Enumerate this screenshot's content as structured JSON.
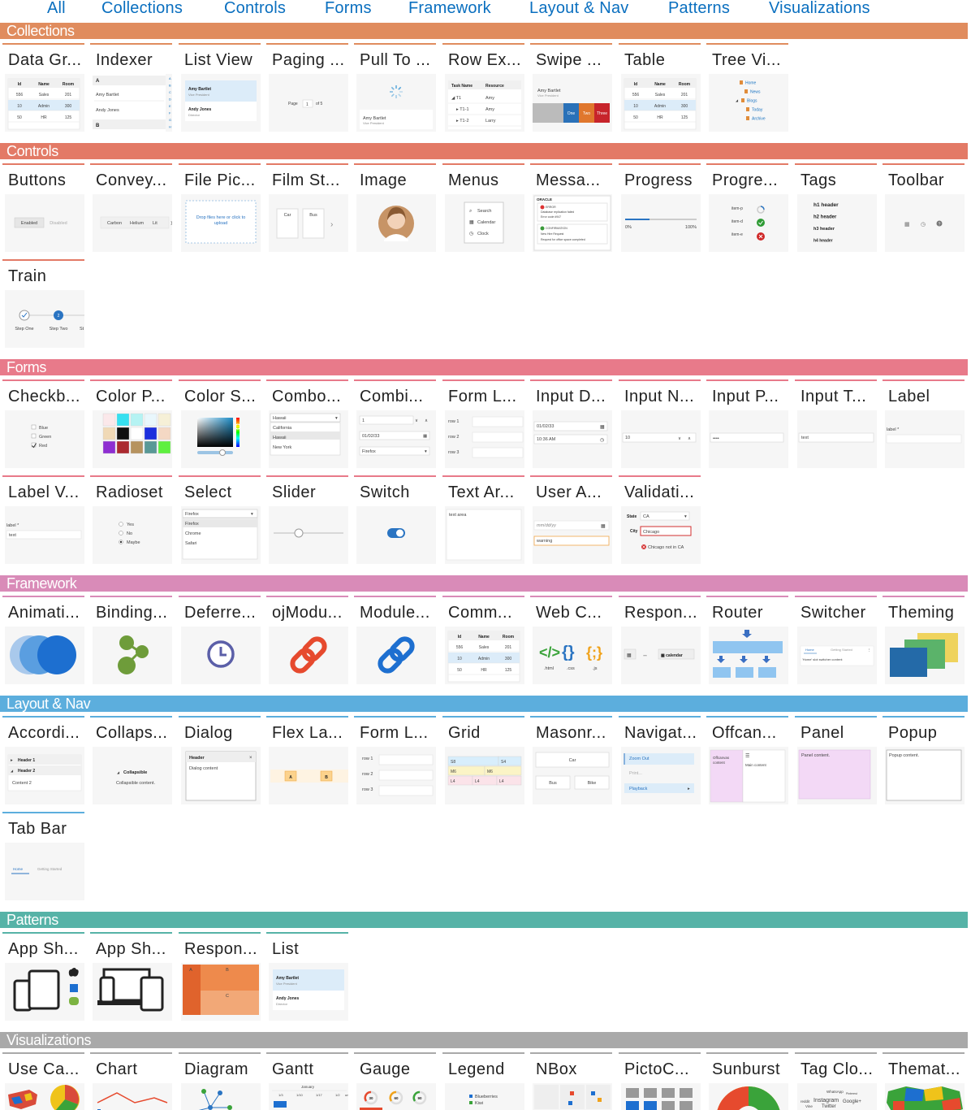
{
  "nav": {
    "tabs": [
      "All",
      "Collections",
      "Controls",
      "Forms",
      "Framework",
      "Layout & Nav",
      "Patterns",
      "Visualizations"
    ]
  },
  "colors": {
    "link": "#0a6fbf",
    "collections": "#e08c5e",
    "controls": "#e37a66",
    "forms": "#e87a8a",
    "framework": "#d98bb8",
    "layout_nav": "#5caedd",
    "patterns": "#56b3a7",
    "visualizations": "#a9a9a9"
  },
  "sections": [
    {
      "id": "collections",
      "title": "Collections",
      "items": [
        {
          "title": "Data Gr...",
          "thumb": "datagrid"
        },
        {
          "title": "Indexer",
          "thumb": "indexer"
        },
        {
          "title": "List View",
          "thumb": "listview"
        },
        {
          "title": "Paging ...",
          "thumb": "paging"
        },
        {
          "title": "Pull To ...",
          "thumb": "pullto"
        },
        {
          "title": "Row Ex...",
          "thumb": "rowexp"
        },
        {
          "title": "Swipe ...",
          "thumb": "swipe"
        },
        {
          "title": "Table",
          "thumb": "table"
        },
        {
          "title": "Tree Vi...",
          "thumb": "tree"
        }
      ]
    },
    {
      "id": "controls",
      "title": "Controls",
      "items": [
        {
          "title": "Buttons",
          "thumb": "buttons"
        },
        {
          "title": "Convey...",
          "thumb": "conveyor"
        },
        {
          "title": "File Pic...",
          "thumb": "filepicker"
        },
        {
          "title": "Film St...",
          "thumb": "filmstrip"
        },
        {
          "title": "Image",
          "thumb": "image"
        },
        {
          "title": "Menus",
          "thumb": "menus"
        },
        {
          "title": "Messa...",
          "thumb": "messages"
        },
        {
          "title": "Progress",
          "thumb": "progress"
        },
        {
          "title": "Progre...",
          "thumb": "progresscircle"
        },
        {
          "title": "Tags",
          "thumb": "tags"
        },
        {
          "title": "Toolbar",
          "thumb": "toolbar"
        },
        {
          "title": "Train",
          "thumb": "train"
        }
      ]
    },
    {
      "id": "forms",
      "title": "Forms",
      "items": [
        {
          "title": "Checkb...",
          "thumb": "checkbox"
        },
        {
          "title": "Color P...",
          "thumb": "colorpalette"
        },
        {
          "title": "Color S...",
          "thumb": "colorspectrum"
        },
        {
          "title": "Combo...",
          "thumb": "combo"
        },
        {
          "title": "Combi...",
          "thumb": "combi"
        },
        {
          "title": "Form L...",
          "thumb": "formlayout"
        },
        {
          "title": "Input D...",
          "thumb": "inputdate"
        },
        {
          "title": "Input N...",
          "thumb": "inputnumber"
        },
        {
          "title": "Input P...",
          "thumb": "inputpassword"
        },
        {
          "title": "Input T...",
          "thumb": "inputtext"
        },
        {
          "title": "Label",
          "thumb": "label"
        },
        {
          "title": "Label V...",
          "thumb": "labelvalue"
        },
        {
          "title": "Radioset",
          "thumb": "radioset"
        },
        {
          "title": "Select",
          "thumb": "select"
        },
        {
          "title": "Slider",
          "thumb": "slider"
        },
        {
          "title": "Switch",
          "thumb": "switch"
        },
        {
          "title": "Text Ar...",
          "thumb": "textarea"
        },
        {
          "title": "User A...",
          "thumb": "useraction"
        },
        {
          "title": "Validati...",
          "thumb": "validation"
        }
      ]
    },
    {
      "id": "framework",
      "title": "Framework",
      "items": [
        {
          "title": "Animati...",
          "thumb": "animation"
        },
        {
          "title": "Binding...",
          "thumb": "binding"
        },
        {
          "title": "Deferre...",
          "thumb": "deferred"
        },
        {
          "title": "ojModu...",
          "thumb": "ojmodule"
        },
        {
          "title": "Module...",
          "thumb": "modulelink"
        },
        {
          "title": "Comm...",
          "thumb": "common"
        },
        {
          "title": "Web C...",
          "thumb": "webcomp"
        },
        {
          "title": "Respon...",
          "thumb": "responsive"
        },
        {
          "title": "Router",
          "thumb": "router"
        },
        {
          "title": "Switcher",
          "thumb": "switcher"
        },
        {
          "title": "Theming",
          "thumb": "theming"
        }
      ]
    },
    {
      "id": "layout_nav",
      "title": "Layout & Nav",
      "items": [
        {
          "title": "Accordi...",
          "thumb": "accordion"
        },
        {
          "title": "Collaps...",
          "thumb": "collapsible"
        },
        {
          "title": "Dialog",
          "thumb": "dialog"
        },
        {
          "title": "Flex La...",
          "thumb": "flex"
        },
        {
          "title": "Form L...",
          "thumb": "formlayout2"
        },
        {
          "title": "Grid",
          "thumb": "grid"
        },
        {
          "title": "Masonr...",
          "thumb": "masonry"
        },
        {
          "title": "Navigat...",
          "thumb": "navlist"
        },
        {
          "title": "Offcan...",
          "thumb": "offcanvas"
        },
        {
          "title": "Panel",
          "thumb": "panel"
        },
        {
          "title": "Popup",
          "thumb": "popup"
        },
        {
          "title": "Tab Bar",
          "thumb": "tabbar"
        }
      ]
    },
    {
      "id": "patterns",
      "title": "Patterns",
      "items": [
        {
          "title": "App Sh...",
          "thumb": "appshell1"
        },
        {
          "title": "App Sh...",
          "thumb": "appshell2"
        },
        {
          "title": "Respon...",
          "thumb": "responsivelayout"
        },
        {
          "title": "List",
          "thumb": "list"
        }
      ]
    },
    {
      "id": "visualizations",
      "title": "Visualizations",
      "items": [
        {
          "title": "Use Ca...",
          "thumb": "usecase"
        },
        {
          "title": "Chart",
          "thumb": "chart"
        },
        {
          "title": "Diagram",
          "thumb": "diagram"
        },
        {
          "title": "Gantt",
          "thumb": "gantt"
        },
        {
          "title": "Gauge",
          "thumb": "gauge"
        },
        {
          "title": "Legend",
          "thumb": "legend"
        },
        {
          "title": "NBox",
          "thumb": "nbox"
        },
        {
          "title": "PictoC...",
          "thumb": "picto"
        },
        {
          "title": "Sunburst",
          "thumb": "sunburst"
        },
        {
          "title": "Tag Clo...",
          "thumb": "tagcloud"
        },
        {
          "title": "Themat...",
          "thumb": "thematic"
        }
      ]
    }
  ],
  "thumb_text": {
    "grid_headers": [
      "Id",
      "Name",
      "Room"
    ],
    "grid_rows": [
      [
        "556",
        "Sales",
        "201"
      ],
      [
        "10",
        "Admin",
        "300"
      ],
      [
        "50",
        "HR",
        "125"
      ]
    ],
    "index_letters": [
      "A",
      "B"
    ],
    "index_names": [
      "Amy Bartlet",
      "Andy Jones"
    ],
    "index_rail": [
      "A",
      "B",
      "C",
      "D",
      "E",
      "F",
      "G",
      "H"
    ],
    "person1_name": "Amy Bartlet",
    "person1_role": "Vice President",
    "person2_name": "Andy Jones",
    "person2_role": "Director",
    "paging": [
      "Page",
      "1",
      "of 5"
    ],
    "rowexp_headers": [
      "Task Name",
      "Resource"
    ],
    "rowexp_rows": [
      [
        "T1",
        "Amy"
      ],
      [
        "T1-1",
        "Amy"
      ],
      [
        "T1-2",
        "Larry"
      ]
    ],
    "swipe_actions": [
      "One",
      "Two",
      "Three"
    ],
    "tree_items": [
      "Home",
      "News",
      "Blogs",
      "Today",
      "Archive"
    ],
    "buttons": [
      "Enabled",
      "Disabled"
    ],
    "conveyor": [
      "Carbon",
      "Helium",
      "Lit"
    ],
    "filepicker": [
      "Drop files here or click to",
      "upload"
    ],
    "filmstrip": [
      "Car",
      "Bus"
    ],
    "menus": [
      "Search",
      "Calendar",
      "Clock"
    ],
    "messages": [
      "ORACLE",
      "ERROR",
      "Database replication failed",
      "Error code #947",
      "CONFIRMATION",
      "New Hire Request",
      "Request for office space completed"
    ],
    "progress": [
      "0%",
      "100%"
    ],
    "progress_items": [
      "item-p",
      "item-d",
      "item-e"
    ],
    "tags": [
      "h1 header",
      "h2 header",
      "h3 header",
      "h4 header"
    ],
    "train": [
      "Step One",
      "Step Two",
      "St"
    ],
    "checkbox": [
      "Blue",
      "Green",
      "Red"
    ],
    "combo": [
      "Hawaii",
      "California",
      "Hawaii",
      "New York"
    ],
    "combi": [
      "1",
      "01/02/33",
      "Firefox"
    ],
    "formrows": [
      "row 1",
      "row 2",
      "row 3"
    ],
    "inputdate": [
      "01/02/33",
      "10:36 AM"
    ],
    "inputnumber": "10",
    "inputpassword": "••••",
    "inputtext": "text",
    "label": "label",
    "labelvalue": [
      "label",
      "text"
    ],
    "radioset": [
      "Yes",
      "No",
      "Maybe"
    ],
    "select": [
      "Firefox",
      "Firefox",
      "Chrome",
      "Safari"
    ],
    "textarea": "text area",
    "useraction": [
      "mm/dd/yy",
      "warning"
    ],
    "validation": [
      "State",
      "CA",
      "City",
      "Chicago",
      "Chicago not in CA"
    ],
    "webcomp": [
      ".html",
      ".css",
      ".js"
    ],
    "responsive": [
      "calendar"
    ],
    "switcher": [
      "Home",
      "Getting Started",
      "'Home' slot switcher content"
    ],
    "accordion": [
      "Header 1",
      "Header 2",
      "Content 2"
    ],
    "collapsible": [
      "Collapsible",
      "Collapsible content."
    ],
    "dialog": [
      "Header",
      "Dialog content"
    ],
    "flex": [
      "A",
      "B"
    ],
    "gridcells": [
      "S8",
      "S4",
      "M6",
      "M6",
      "L4",
      "L4",
      "L4"
    ],
    "masonry": [
      "Car",
      "Bus",
      "Bike"
    ],
    "navlist": [
      "Zoom Out",
      "Print...",
      "Playback"
    ],
    "offcanvas": [
      "Offcanvas content",
      "Main content"
    ],
    "panel": "Panel content.",
    "popup": "Popup content.",
    "tabbar": [
      "Home",
      "Getting Started"
    ],
    "resp_layout": [
      "A",
      "B",
      "C"
    ],
    "gantt": [
      "January",
      "1/3",
      "1/10",
      "1/17",
      "1/2"
    ],
    "gauge": [
      "30",
      "60",
      "90"
    ],
    "legend": [
      "Blueberries",
      "Kiwi"
    ],
    "tagcloud": [
      "WhatsApp",
      "Pinterest",
      "reddit",
      "Instagram",
      "Google+",
      "Vine",
      "Twitter"
    ]
  }
}
